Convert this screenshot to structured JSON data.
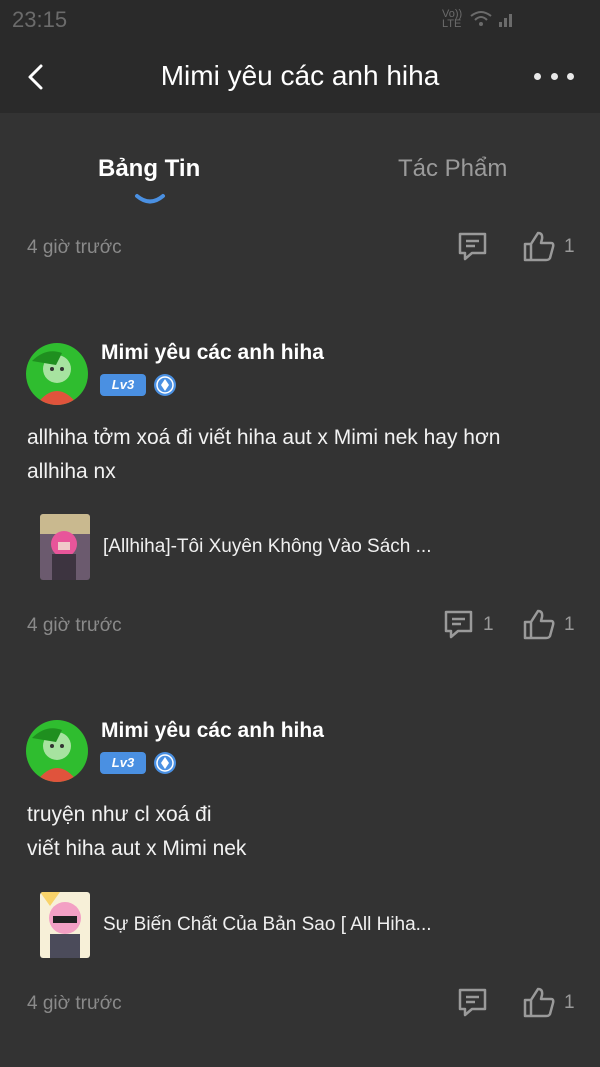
{
  "status": {
    "time": "23:15",
    "net": "Vo)) LTE"
  },
  "header": {
    "title": "Mimi yêu các anh hiha"
  },
  "tabs": [
    {
      "label": "Bảng Tin"
    },
    {
      "label": "Tác Phẩm"
    }
  ],
  "top_meta": {
    "time": "4 giờ trước",
    "like_count": "1"
  },
  "posts": [
    {
      "author": "Mimi yêu các anh hiha",
      "level": "Lv3",
      "text_line1": "allhiha tởm xoá đi viết hiha aut x Mimi nek hay hơn",
      "text_line2": "allhiha nx",
      "book_title": "[Allhiha]-Tôi Xuyên Không Vào Sách ...",
      "time": "4 giờ trước",
      "comment_count": "1",
      "like_count": "1"
    },
    {
      "author": "Mimi yêu các anh hiha",
      "level": "Lv3",
      "text_line1": "truyện như cl xoá đi",
      "text_line2": "viết hiha aut x Mimi nek",
      "book_title": "Sự Biến Chất Của Bản Sao [ All Hiha...",
      "time": "4 giờ trước",
      "like_count": "1"
    }
  ],
  "colors": {
    "background": "#333333",
    "bar": "#2a2a2a",
    "accent": "#4a90e2",
    "muted": "#8a8a8a"
  }
}
